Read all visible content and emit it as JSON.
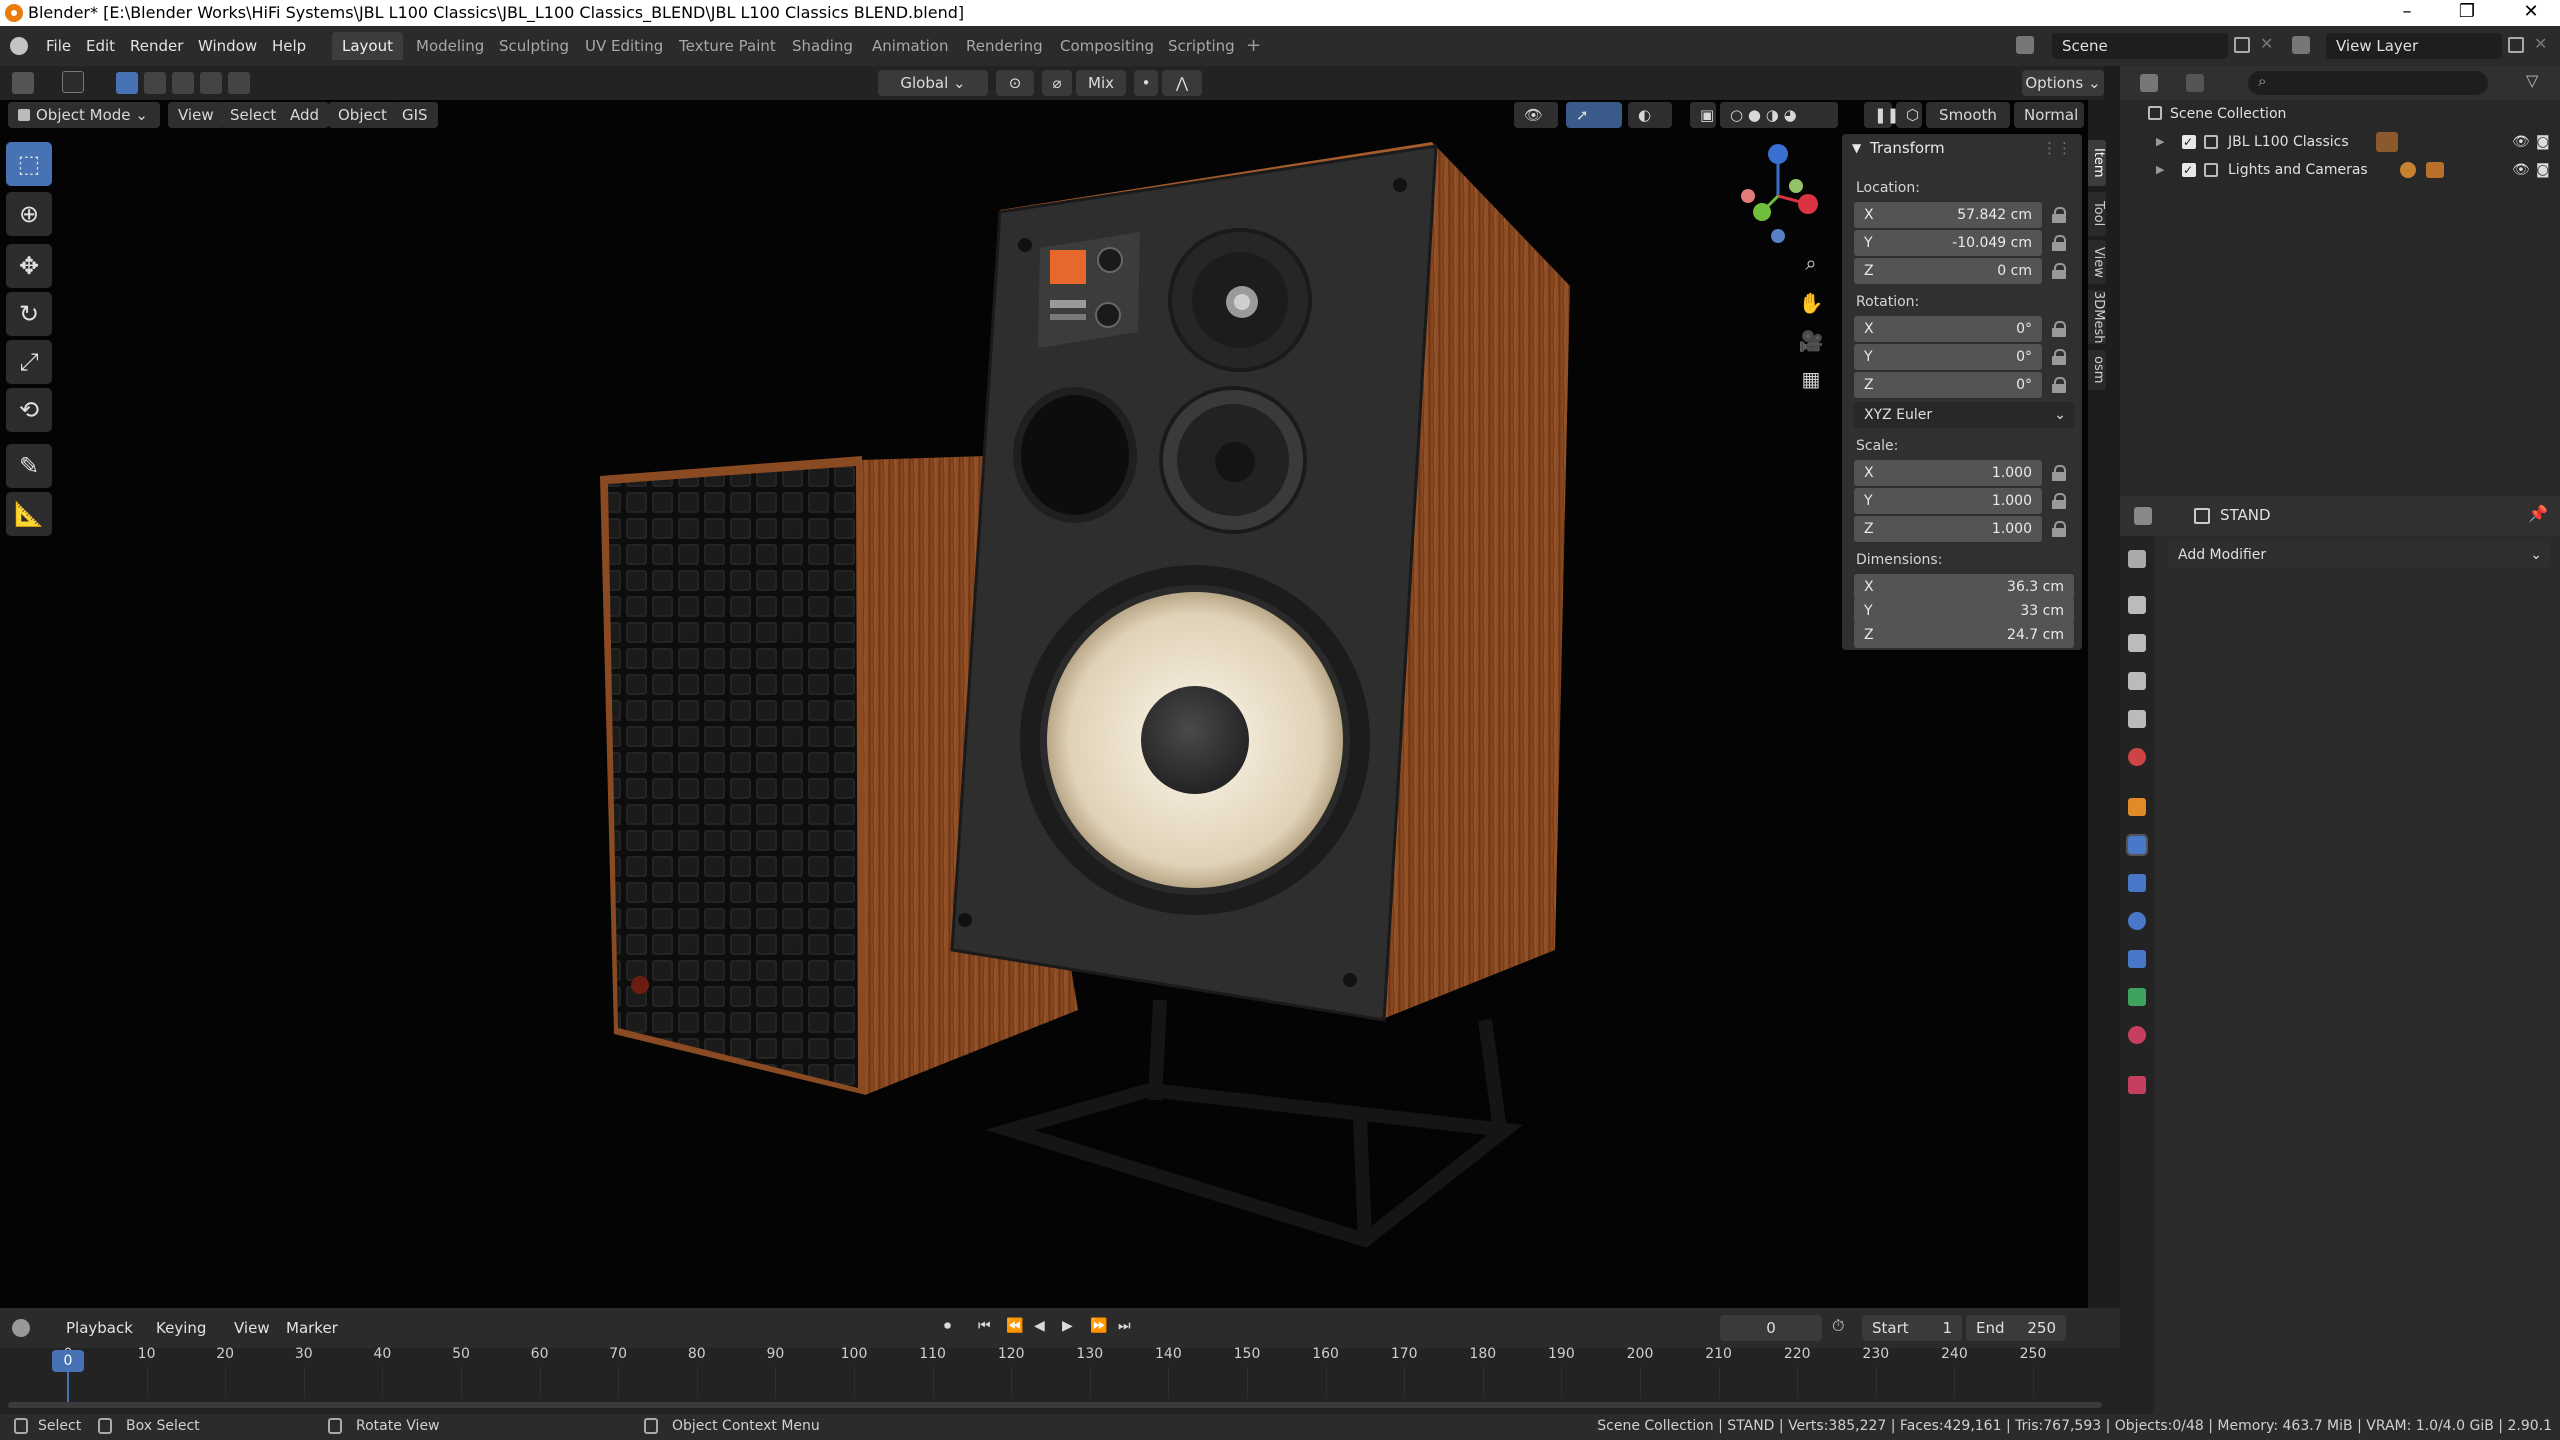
{
  "window": {
    "title": "Blender* [E:\\Blender Works\\HiFi Systems\\JBL L100 Classics\\JBL_L100 Classics_BLEND\\JBL L100 Classics BLEND.blend]"
  },
  "menu": {
    "items": [
      "File",
      "Edit",
      "Render",
      "Window",
      "Help"
    ],
    "workspaces": [
      "Layout",
      "Modeling",
      "Sculpting",
      "UV Editing",
      "Texture Paint",
      "Shading",
      "Animation",
      "Rendering",
      "Compositing",
      "Scripting"
    ],
    "active_workspace": "Layout",
    "scene": "Scene",
    "view_layer": "View Layer"
  },
  "tool_header": {
    "orientation": "Global",
    "proportional": "Mix",
    "options": "Options"
  },
  "viewport_header": {
    "mode": "Object Mode",
    "menus": [
      "View",
      "Select",
      "Add",
      "Object",
      "GIS"
    ],
    "smooth": "Smooth",
    "normal": "Normal"
  },
  "npanel": {
    "section": "Transform",
    "location_label": "Location:",
    "location": [
      {
        "axis": "X",
        "value": "57.842 cm"
      },
      {
        "axis": "Y",
        "value": "-10.049 cm"
      },
      {
        "axis": "Z",
        "value": "0 cm"
      }
    ],
    "rotation_label": "Rotation:",
    "rotation": [
      {
        "axis": "X",
        "value": "0°"
      },
      {
        "axis": "Y",
        "value": "0°"
      },
      {
        "axis": "Z",
        "value": "0°"
      }
    ],
    "rotation_mode": "XYZ Euler",
    "scale_label": "Scale:",
    "scale": [
      {
        "axis": "X",
        "value": "1.000"
      },
      {
        "axis": "Y",
        "value": "1.000"
      },
      {
        "axis": "Z",
        "value": "1.000"
      }
    ],
    "dimensions_label": "Dimensions:",
    "dimensions": [
      {
        "axis": "X",
        "value": "36.3 cm"
      },
      {
        "axis": "Y",
        "value": "33 cm"
      },
      {
        "axis": "Z",
        "value": "24.7 cm"
      }
    ],
    "tabs": [
      "Item",
      "Tool",
      "View",
      "3DMesh",
      "osm"
    ]
  },
  "outliner": {
    "root": "Scene Collection",
    "collections": [
      "JBL L100 Classics",
      "Lights and Cameras"
    ]
  },
  "properties": {
    "object_name": "STAND",
    "add_modifier": "Add Modifier"
  },
  "timeline": {
    "menus": [
      "Playback",
      "Keying",
      "View",
      "Marker"
    ],
    "current_frame": "0",
    "start_label": "Start",
    "start": "1",
    "end_label": "End",
    "end": "250",
    "ticks": [
      "0",
      "10",
      "20",
      "30",
      "40",
      "50",
      "60",
      "70",
      "80",
      "90",
      "100",
      "110",
      "120",
      "130",
      "140",
      "150",
      "160",
      "170",
      "180",
      "190",
      "200",
      "210",
      "220",
      "230",
      "240",
      "250"
    ]
  },
  "statusbar": {
    "select": "Select",
    "box_select": "Box Select",
    "rotate_view": "Rotate View",
    "context_menu": "Object Context Menu",
    "stats": "Scene Collection | STAND | Verts:385,227 | Faces:429,161 | Tris:767,593 | Objects:0/48 | Memory: 463.7 MiB | VRAM: 1.0/4.0 GiB | 2.90.1"
  },
  "colors": {
    "accent": "#4772b3",
    "wood": "#8a4a22",
    "cabinet": "#2f2f2f"
  }
}
